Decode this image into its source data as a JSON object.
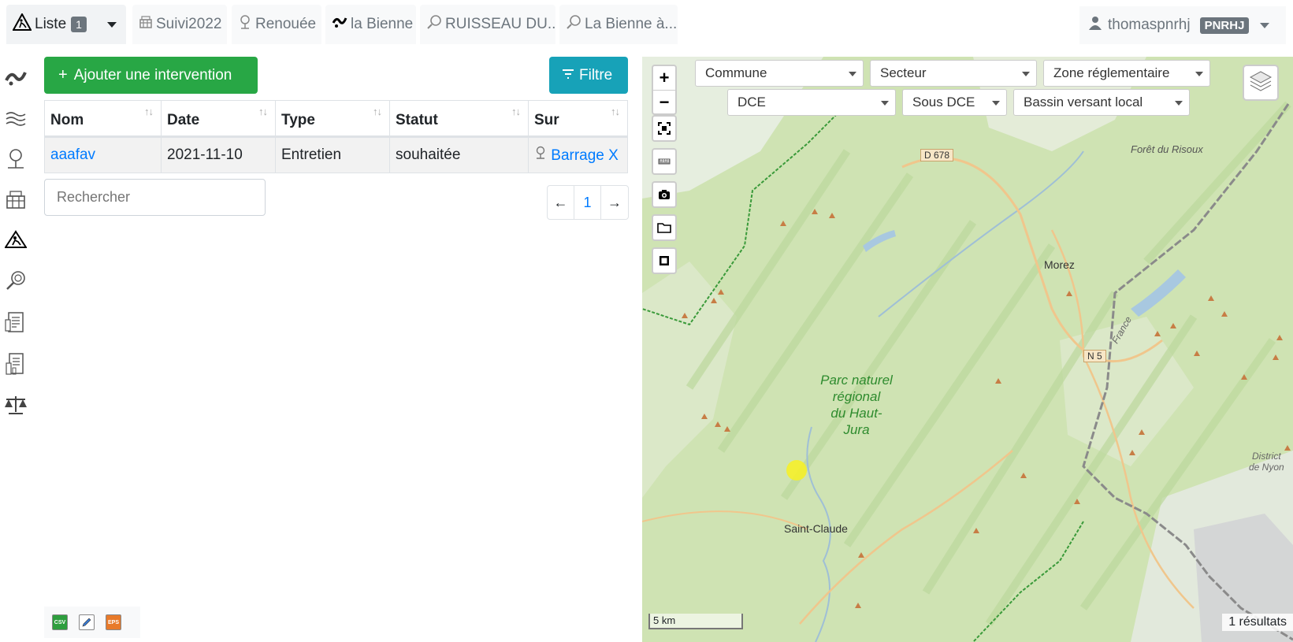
{
  "tabs": [
    {
      "label": "Liste",
      "badge": "1",
      "icon": "intervention-icon",
      "active": true
    },
    {
      "label": "Suivi2022",
      "icon": "dam-icon"
    },
    {
      "label": "Renouée",
      "icon": "plant-icon"
    },
    {
      "label": "la Bienne",
      "icon": "river-icon"
    },
    {
      "label": "RUISSEAU DU...",
      "icon": "search-map-icon"
    },
    {
      "label": "La Bienne à...",
      "icon": "search-map-icon"
    }
  ],
  "user": {
    "name": "thomaspnrhj",
    "structure": "PNRHJ",
    "icon": "user-icon"
  },
  "sidebar": {
    "items": [
      {
        "name": "river-icon"
      },
      {
        "name": "waves-icon"
      },
      {
        "name": "plant-icon"
      },
      {
        "name": "dam-icon"
      },
      {
        "name": "intervention-icon"
      },
      {
        "name": "prospection-icon"
      },
      {
        "name": "report-icon"
      },
      {
        "name": "document-icon"
      },
      {
        "name": "balance-icon"
      }
    ]
  },
  "actions": {
    "add_label": "Ajouter une intervention",
    "filter_label": "Filtre"
  },
  "table": {
    "columns": [
      "Nom",
      "Date",
      "Type",
      "Statut",
      "Sur"
    ],
    "rows": [
      {
        "nom": "aaafav",
        "date": "2021-11-10",
        "type": "Entretien",
        "statut": "souhaitée",
        "sur": "Barrage X"
      }
    ]
  },
  "search": {
    "placeholder": "Rechercher"
  },
  "pagination": {
    "prev": "←",
    "page": "1",
    "next": "→"
  },
  "exports": [
    "csv-export-icon",
    "edit-icon",
    "eps-export-icon"
  ],
  "map": {
    "filters": [
      "Commune",
      "Secteur",
      "Zone réglementaire",
      "DCE",
      "Sous DCE",
      "Bassin versant local"
    ],
    "labels": {
      "foret": "Forêt du Risoux",
      "road1": "D 678",
      "road2": "N 5",
      "morez": "Morez",
      "parc1": "Parc naturel",
      "parc2": "régional",
      "parc3": "du Haut-",
      "parc4": "Jura",
      "saint_claude": "Saint-Claude",
      "district1": "District",
      "district2": "de Nyon",
      "france": "France"
    },
    "scale": "5 km",
    "results": "1 résultats",
    "colors": {
      "border": "#7f7f7f",
      "parc": "#2e8b2e",
      "marker": "#f5ef2a"
    }
  }
}
